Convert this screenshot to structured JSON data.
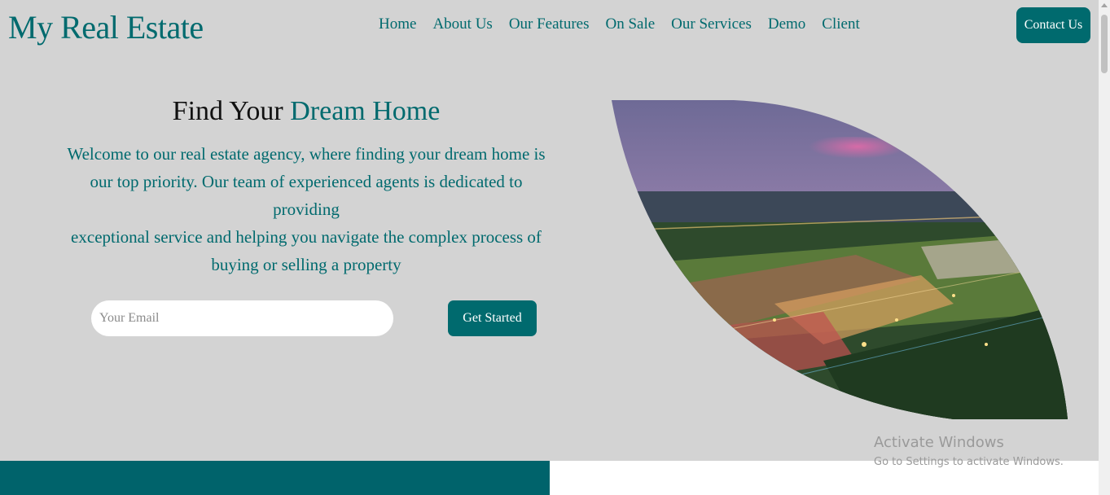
{
  "header": {
    "logo": "My Real Estate",
    "nav": [
      "Home",
      "About Us",
      "Our Features",
      "On Sale",
      "Our Services",
      "Demo",
      "Client"
    ],
    "contact_label": "Contact Us"
  },
  "hero": {
    "title_plain": "Find Your ",
    "title_accent": "Dream Home",
    "paragraph_lines": [
      "Welcome to our real estate agency, where finding your dream home is",
      "our top priority. Our team of experienced agents is dedicated to",
      "providing",
      "exceptional service and helping you navigate the complex process of",
      "buying or selling a property"
    ],
    "email_placeholder": "Your Email",
    "cta_label": "Get Started"
  },
  "watermark": {
    "title": "Activate Windows",
    "subtitle": "Go to Settings to activate Windows."
  },
  "colors": {
    "accent": "#006a6e",
    "background": "#d3d3d3"
  }
}
